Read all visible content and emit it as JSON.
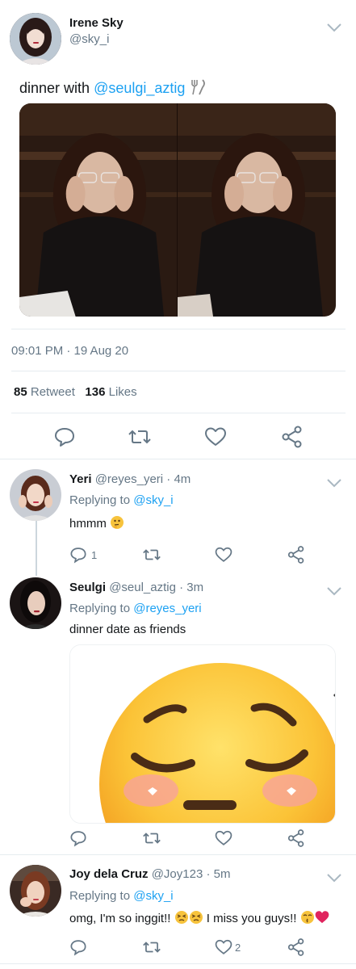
{
  "main_tweet": {
    "name": "Irene Sky",
    "handle": "@sky_i",
    "text_prefix": "dinner with ",
    "mention": "@seulgi_aztig",
    "timestamp": "09:01 PM · 19 Aug 20",
    "retweets_count": "85",
    "retweets_label": "Retweet",
    "likes_count": "136",
    "likes_label": "Likes",
    "icons": [
      "fork-knife-emoji",
      "chevron-down-icon",
      "reply-icon",
      "retweet-icon",
      "like-icon",
      "share-icon"
    ]
  },
  "replies": [
    {
      "name": "Yeri",
      "handle": "@reyes_yeri",
      "time": "· 4m",
      "replying_prefix": "Replying to ",
      "replying_to": "@sky_i",
      "text": "hmmm",
      "reply_count": "1",
      "like_count": ""
    },
    {
      "name": "Seulgi",
      "handle": "@seul_aztig",
      "time": "· 3m",
      "replying_prefix": "Replying to ",
      "replying_to": "@reyes_yeri",
      "text": "dinner date as friends",
      "reply_count": "",
      "like_count": ""
    },
    {
      "name": "Joy dela Cruz",
      "handle": "@Joy123",
      "time": "· 5m",
      "replying_prefix": "Replying to ",
      "replying_to": "@sky_i",
      "text_a": "omg, I'm so inggit!!",
      "text_b": "I miss you guys!!",
      "reply_count": "",
      "like_count": "2"
    }
  ],
  "colors": {
    "accent": "#1da1f2",
    "text": "#14171a",
    "secondary": "#657786",
    "divider": "#e6ecf0",
    "heart": "#e0245e"
  }
}
